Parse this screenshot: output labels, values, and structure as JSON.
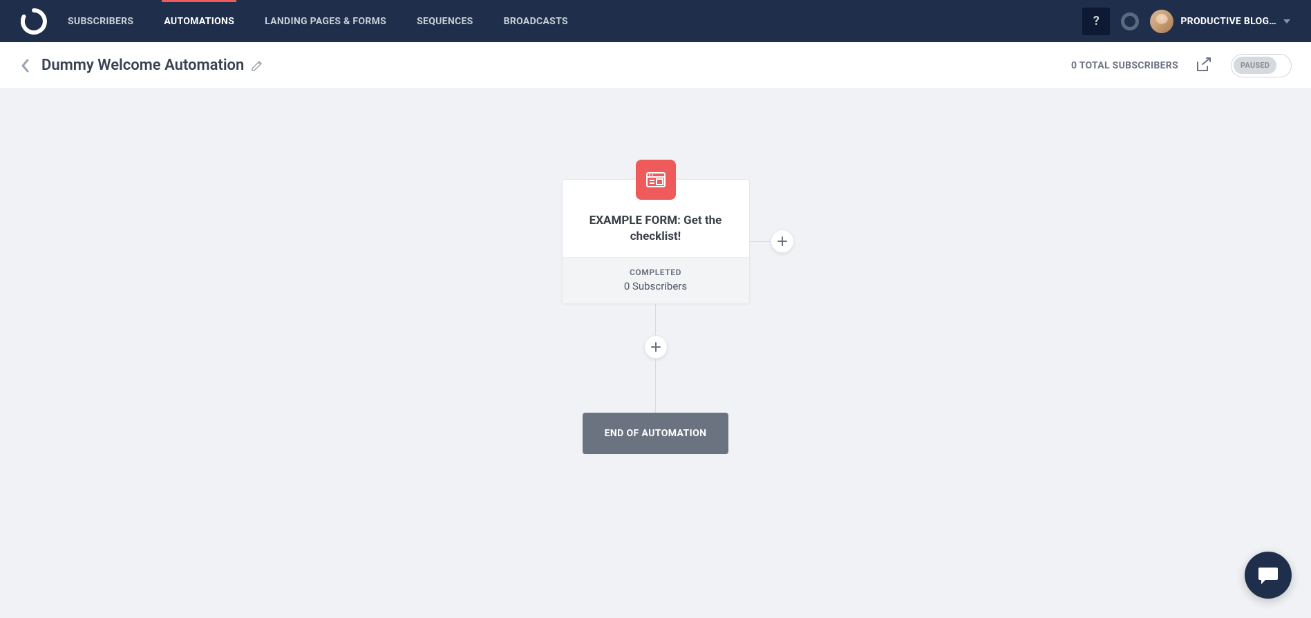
{
  "nav": {
    "items": [
      {
        "label": "SUBSCRIBERS"
      },
      {
        "label": "AUTOMATIONS"
      },
      {
        "label": "LANDING PAGES & FORMS"
      },
      {
        "label": "SEQUENCES"
      },
      {
        "label": "BROADCASTS"
      }
    ],
    "help_label": "?",
    "account_name": "PRODUCTIVE BLOG…"
  },
  "header": {
    "title": "Dummy Welcome Automation",
    "total_label": "0 TOTAL SUBSCRIBERS",
    "status_label": "PAUSED"
  },
  "node": {
    "title": "EXAMPLE FORM: Get the checklist!",
    "status": "COMPLETED",
    "subs": "0 Subscribers"
  },
  "end_label": "END OF AUTOMATION"
}
